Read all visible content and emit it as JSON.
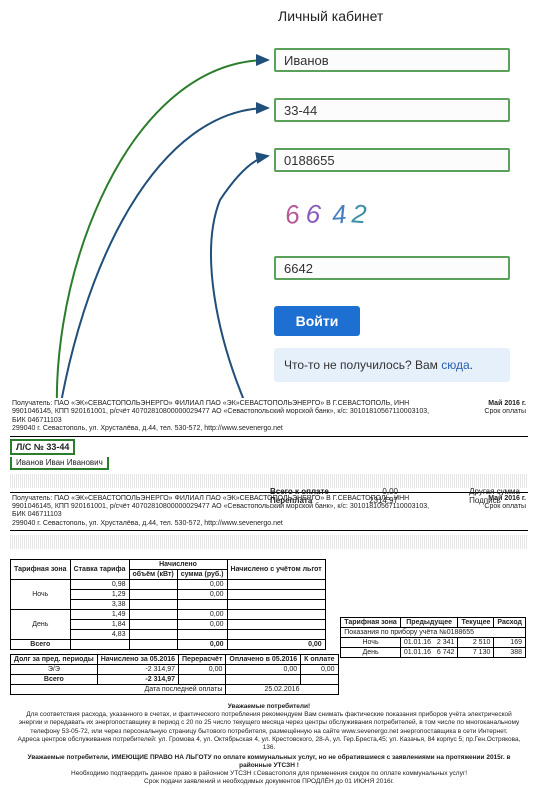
{
  "login": {
    "title": "Личный кабинет",
    "surname": "Иванов",
    "account": "33-44",
    "contract": "0188655",
    "captcha_img": "6642",
    "captcha_input": "6642",
    "button": "Войти",
    "help_text": "Что-то не получилось? Вам ",
    "help_link": "сюда"
  },
  "doc": {
    "payee_line": "Получатель: ПАО «ЭК»СЕВАСТОПОЛЬЭНЕРГО» ФИЛИАЛ ПАО «ЭК»СЕВАСТОПОЛЬЭНЕРГО» В Г.СЕВАСТОПОЛЬ, ИНН 9901046145, КПП 920161001, р/счёт 40702810800000029477 АО «Севастопольский морской банк», к/с: 30101810567110003103, БИК 046711103",
    "addr_line": "299040 г. Севастополь, ул. Хрусталёва, д.44, тел. 530-572, http://www.sevenergo.net",
    "period_label": "Май 2016 г.",
    "period_sub": "Срок оплаты",
    "account_label": "Л/С № 33-44",
    "account_name": "Иванов Иван Иванович",
    "summary": {
      "total_label": "Всего к оплате",
      "total_value": "0,00",
      "overpay_label": "Переплата",
      "overpay_value": "2314,97",
      "other_label": "Другая сумма",
      "sign_label": "Подпись"
    },
    "tarif": {
      "headers": [
        "Тарифная зона",
        "Ставка тарифа",
        "Начислено",
        "Начислено с учётом льгот"
      ],
      "sub_headers": [
        "объём (кВт)",
        "сумма (руб.)"
      ],
      "rows": [
        {
          "zone": "",
          "rate": "0,98",
          "vol": "",
          "sum": "0,00",
          "lgot": ""
        },
        {
          "zone": "Ночь",
          "rate": "1,29",
          "vol": "",
          "sum": "0,00",
          "lgot": ""
        },
        {
          "zone": "",
          "rate": "3,38",
          "vol": "",
          "sum": "",
          "lgot": ""
        },
        {
          "zone": "",
          "rate": "1,49",
          "vol": "",
          "sum": "0,00",
          "lgot": ""
        },
        {
          "zone": "День",
          "rate": "1,84",
          "vol": "",
          "sum": "0,00",
          "lgot": ""
        },
        {
          "zone": "",
          "rate": "4,83",
          "vol": "",
          "sum": "",
          "lgot": ""
        }
      ],
      "total_label": "Всего",
      "total_sum": "0,00",
      "total_lgot": "0,00"
    },
    "debt": {
      "headers": [
        "Долг за пред. периоды",
        "Начислено за 05.2016",
        "Перерасчёт",
        "Оплачено в 05.2016",
        "К оплате"
      ],
      "rows": [
        {
          "label": "Э/Э",
          "debt": "-2 314,97",
          "accr": "0,00",
          "recalc": "0,00",
          "paid": "0,00",
          "due": ""
        },
        {
          "label": "Всего",
          "debt": "-2 314,97",
          "accr": "",
          "recalc": "",
          "paid": "",
          "due": ""
        }
      ],
      "last_pay_label": "Дата последней оплаты",
      "last_pay_date": "25.02.2016"
    },
    "meter": {
      "title": "Показания по прибору учёта №0188655",
      "headers": [
        "Тарифная зона",
        "Предыдущее",
        "Текущее",
        "Расход"
      ],
      "rows": [
        {
          "zone": "Ночь",
          "prev_date": "01.01.16",
          "prev": "2 341",
          "cur": "2 510",
          "cons": "169"
        },
        {
          "zone": "День",
          "prev_date": "01.01.16",
          "prev": "6 742",
          "cur": "7 130",
          "cons": "388"
        }
      ]
    },
    "notice_title": "Уважаемые потребители!",
    "notice_body": "Для соответствия расхода, указанного в счетах, и фактического потребления рекомендуем Вам снимать фактические показания приборов учёта электрической энергии и передавать их энергопоставщику в период с 20 по 25 число текущего месяца через центры обслуживания потребителей, в том числе по многоканальному телефону 53-05-72, или через персональную страницу бытового потребителя, размещённую на сайте www.sevenergo.net энергопоставщика в сети Интернет.",
    "notice_addr": "Адреса центров обслуживания потребителей: ул. Громова 4, ул. Октябрьская 4, ул. Крестовского, 28-А, ул. Гер.Бреста,45; ул. Казачья, 84 корпус 5; пр.Ген.Острякова, 136.",
    "notice_lgot": "Уважаемые потребители, ИМЕЮЩИЕ ПРАВО НА ЛЬГОТУ по оплате коммунальных услуг, но не обратившиеся с заявлениями на протяжении 2015г. в районные УТСЗН !",
    "notice_lgot2": "Необходимо подтвердить данное право в районном УТСЗН г.Севастополя для применения скидок по оплате коммунальных услуг!",
    "notice_lgot3": "Срок подачи заявлений и необходимых документов ПРОДЛЁН до 01 ИЮНЯ 2016г."
  }
}
